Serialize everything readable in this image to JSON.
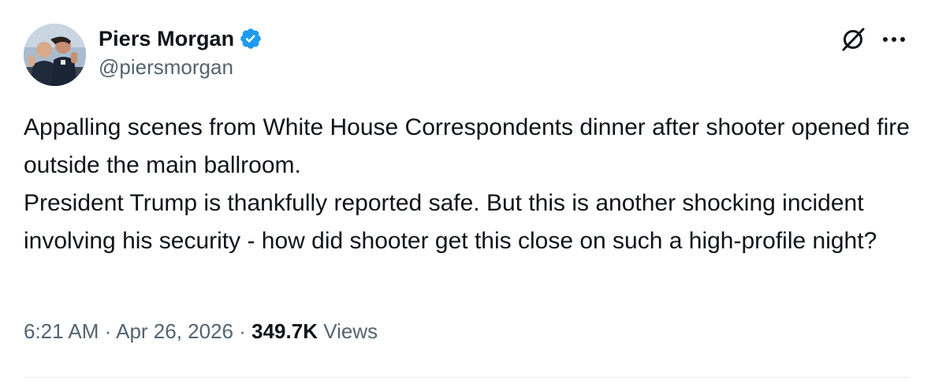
{
  "author": {
    "display_name": "Piers Morgan",
    "handle": "@piersmorgan",
    "verified": true,
    "verified_color": "#1d9bf0"
  },
  "actions": {
    "grok_icon": "grok-icon",
    "more_icon": "more-icon"
  },
  "tweet": {
    "line1": "Appalling scenes from White House Correspondents dinner after shooter opened fire outside the main ballroom.",
    "line2": "President Trump is thankfully reported safe. But this is another shocking incident involving his security - how did shooter get this close on such a high-profile night?"
  },
  "meta": {
    "time": "6:21 AM",
    "separator": "·",
    "date": "Apr 26, 2026",
    "views_count": "349.7K",
    "views_label": "Views"
  }
}
